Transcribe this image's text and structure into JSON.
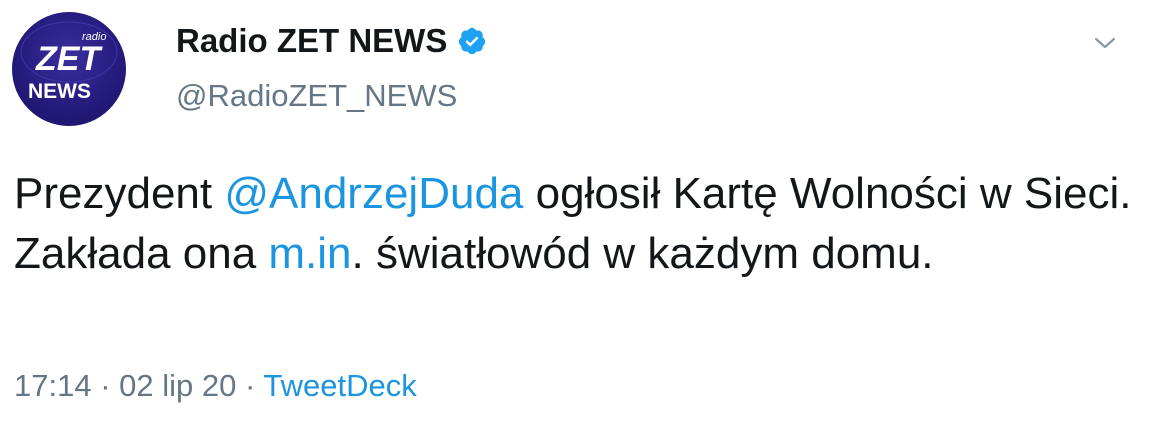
{
  "author": {
    "display_name": "Radio ZET NEWS",
    "handle": "@RadioZET_NEWS",
    "avatar_logo_text": [
      "radio",
      "ZET",
      "NEWS"
    ]
  },
  "tweet": {
    "part1": "Prezydent ",
    "mention": "@AndrzejDuda",
    "part2": " ogłosił Kartę Wolności w Sieci. Zakłada ona ",
    "link": "m.in",
    "part3": ". światłowód w każdym domu."
  },
  "meta": {
    "time": "17:14",
    "separator": " · ",
    "date": "02 lip 20",
    "source": "TweetDeck"
  },
  "colors": {
    "link": "#1b95e0",
    "secondary_text": "#657786",
    "avatar_bg": "#241a7a"
  },
  "icons": [
    "verified-badge-icon",
    "chevron-down-icon"
  ]
}
